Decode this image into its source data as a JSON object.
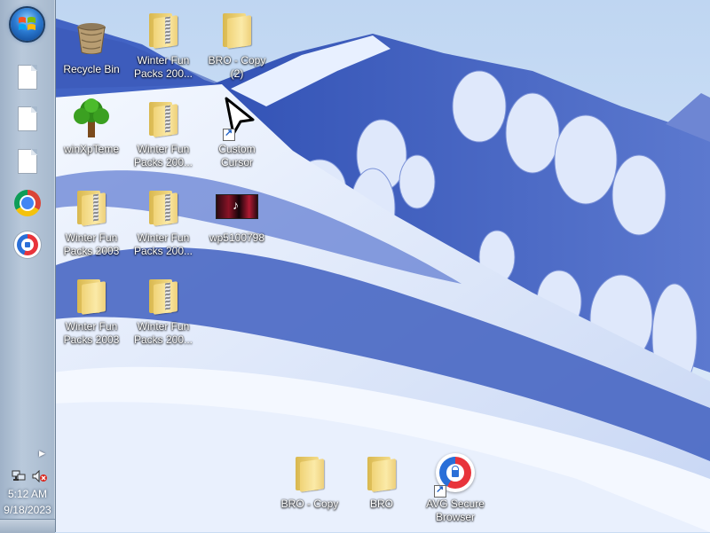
{
  "taskbar": {
    "start_button": "start-orb",
    "pinned": [
      {
        "name": "document-icon"
      },
      {
        "name": "document-icon"
      },
      {
        "name": "document-icon"
      },
      {
        "name": "chrome-icon"
      },
      {
        "name": "avg-secure-browser-icon"
      }
    ],
    "tray": {
      "network_icon": "network-icon",
      "volume_icon": "volume-muted-icon",
      "time": "5:12 AM",
      "date": "9/18/2023"
    }
  },
  "desktop": {
    "icons": [
      {
        "label": "Recycle Bin",
        "type": "recycle-bin"
      },
      {
        "label": "Winter Fun\nPacks 200...",
        "type": "zip-folder"
      },
      {
        "label": "BRO - Copy\n(2)",
        "type": "folder"
      },
      {
        "label": "winXpTeme",
        "type": "tree"
      },
      {
        "label": "Winter Fun\nPacks 200...",
        "type": "zip-folder"
      },
      {
        "label": "Custom\nCursor",
        "type": "cursor-shortcut"
      },
      {
        "label": "Winter Fun\nPacks 2003",
        "type": "zip-folder"
      },
      {
        "label": "Winter Fun\nPacks 200...",
        "type": "zip-folder"
      },
      {
        "label": "wp5100798",
        "type": "image"
      },
      {
        "label": "Winter Fun\nPacks 2003",
        "type": "folder"
      },
      {
        "label": "Winter Fun\nPacks 200...",
        "type": "folder"
      },
      {
        "label": "BRO - Copy",
        "type": "folder"
      },
      {
        "label": "BRO",
        "type": "folder"
      },
      {
        "label": "AVG Secure\nBrowser",
        "type": "avg-shortcut"
      }
    ]
  },
  "colors": {
    "sky": "#c9dcf3",
    "snow_shadow": "#3f5fbf",
    "taskbar": "#b9c9db"
  }
}
